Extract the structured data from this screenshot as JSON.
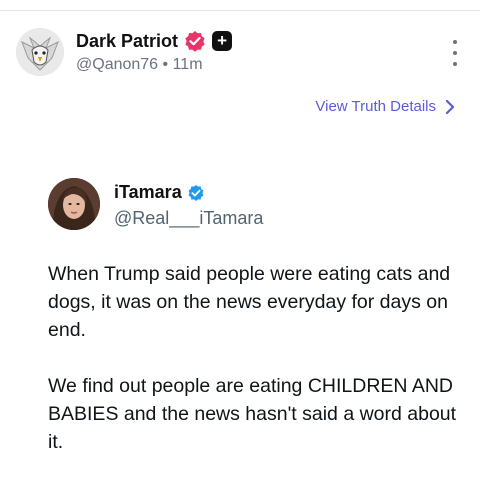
{
  "post": {
    "author_name": "Dark Patriot",
    "handle": "@Qanon76",
    "separator": "•",
    "time": "11m",
    "plus_badge_label": "+",
    "view_details_label": "View Truth Details"
  },
  "quoted": {
    "author_name": "iTamara",
    "handle": "@Real___iTamara",
    "paragraphs": [
      "When Trump said people were eating cats and dogs, it was on the news everyday for days on end.",
      "We find out people are eating CHILDREN AND BABIES and the news hasn't said a word about it."
    ]
  },
  "colors": {
    "link": "#5b5bd6",
    "verified_pink": "#e8336b",
    "verified_blue": "#1d9bf0",
    "muted_text": "#6b7280"
  },
  "icons": {
    "more": "more-vertical-icon",
    "chevron": "chevron-right-icon",
    "verified_pink": "verified-badge-icon",
    "verified_blue": "verified-badge-icon",
    "plus": "plus-badge-icon"
  }
}
